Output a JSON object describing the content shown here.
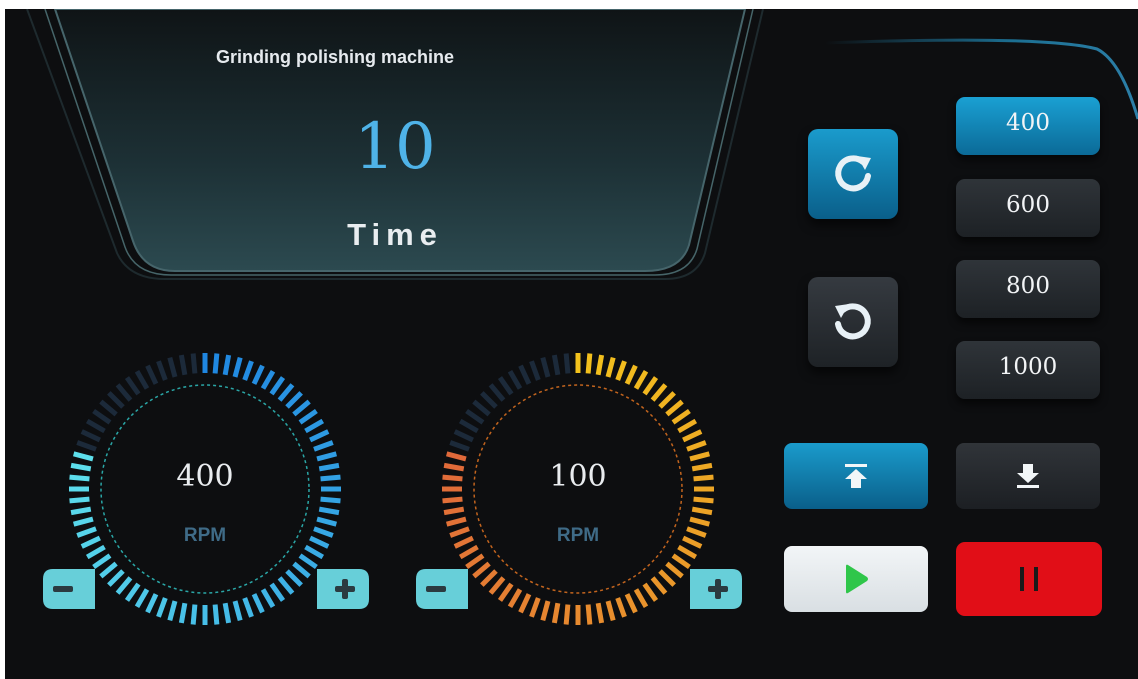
{
  "header": {
    "title": "Grinding polishing machine",
    "time_value": "10",
    "time_label": "Time"
  },
  "gauges": [
    {
      "value": "400",
      "unit": "RPM",
      "minus_icon": "minus-icon",
      "plus_icon": "plus-icon",
      "level": 0.8
    },
    {
      "value": "100",
      "unit": "RPM",
      "minus_icon": "minus-icon",
      "plus_icon": "plus-icon",
      "level": 0.8
    }
  ],
  "rotation": {
    "clockwise_icon": "rotate-clockwise-icon",
    "counterclockwise_icon": "rotate-counterclockwise-icon"
  },
  "presets": [
    "400",
    "600",
    "800",
    "1000"
  ],
  "selected_preset": "400",
  "actions": {
    "raise_icon": "move-up-icon",
    "lower_icon": "move-down-icon",
    "start_icon": "play-icon",
    "pause_icon": "pause-icon"
  },
  "colors": {
    "screen_bg": "#0d0e10",
    "accent_blue": "#1a9bcc",
    "time_value": "#4fb3e8",
    "gauge1_start": "#1f86e0",
    "gauge1_end": "#5fe0ec",
    "gauge2_start": "#f3c21c",
    "gauge2_end": "#e0683a",
    "stepper_fill": "#67cfd9",
    "play_green": "#2fc64a",
    "pause_red": "#e10e17"
  }
}
